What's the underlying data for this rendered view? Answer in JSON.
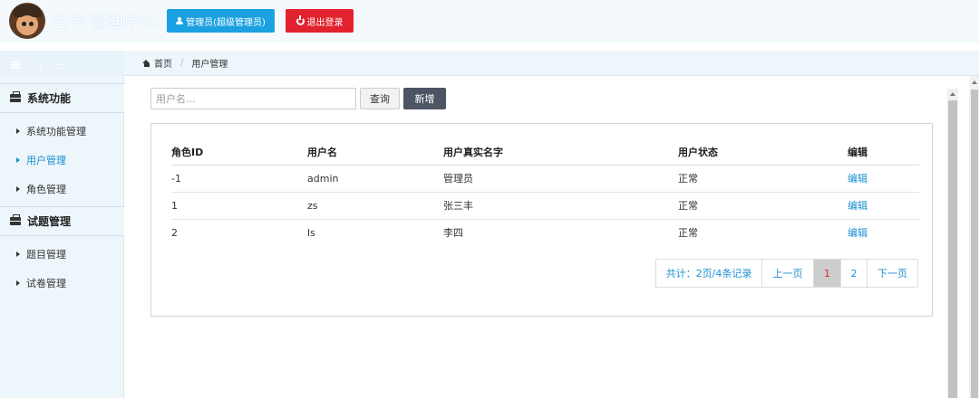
{
  "header": {
    "title": "后台管理中心",
    "admin_button": "管理员(超级管理员)",
    "logout_button": "退出登录"
  },
  "sidebar": {
    "menu_title": "菜单列表",
    "groups": [
      {
        "label": "系统功能",
        "items": [
          {
            "label": "系统功能管理"
          },
          {
            "label": "用户管理",
            "active": true
          },
          {
            "label": "角色管理"
          }
        ]
      },
      {
        "label": "试题管理",
        "items": [
          {
            "label": "题目管理"
          },
          {
            "label": "试卷管理"
          }
        ]
      }
    ]
  },
  "breadcrumb": {
    "home": "首页",
    "current": "用户管理"
  },
  "search": {
    "placeholder": "用户名...",
    "query_button": "查询",
    "add_button": "新增"
  },
  "table": {
    "headers": [
      "角色ID",
      "用户名",
      "用户真实名字",
      "用户状态",
      "编辑"
    ],
    "rows": [
      [
        "-1",
        "admin",
        "管理员",
        "正常",
        "编辑"
      ],
      [
        "1",
        "zs",
        "张三丰",
        "正常",
        "编辑"
      ],
      [
        "2",
        "ls",
        "李四",
        "正常",
        "编辑"
      ]
    ]
  },
  "pagination": {
    "info": "共计：2页/4条记录",
    "prev": "上一页",
    "pages": [
      "1",
      "2"
    ],
    "current": "1",
    "next": "下一页"
  },
  "colors": {
    "admin_button": "#1ba1e2",
    "logout_button": "#e2232f",
    "add_button": "#4d5565",
    "link": "#1b8fd2"
  }
}
